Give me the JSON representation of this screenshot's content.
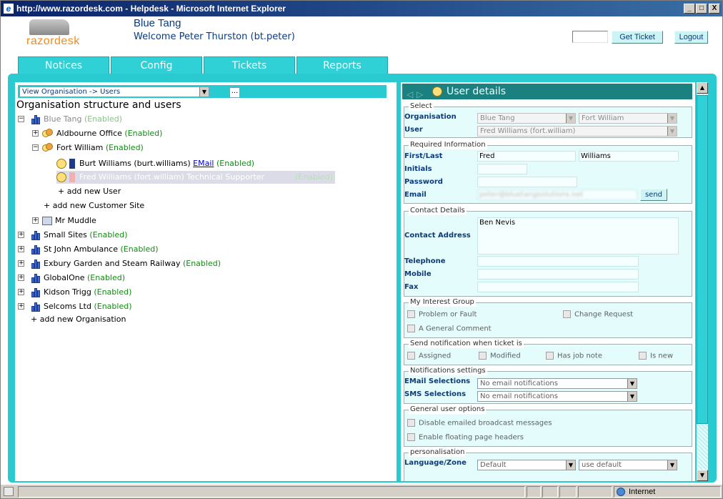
{
  "window": {
    "title": "http://www.razordesk.com - Helpdesk - Microsoft Internet Explorer",
    "min": "_",
    "max": "□",
    "close": "X"
  },
  "header": {
    "logo_text": "razordesk",
    "org_name": "Blue Tang",
    "welcome": "Welcome Peter Thurston (bt.peter)",
    "ticket_input": "",
    "get_ticket": "Get Ticket",
    "logout": "Logout"
  },
  "tabs": [
    {
      "label": "Notices"
    },
    {
      "label": "Config"
    },
    {
      "label": "Tickets"
    },
    {
      "label": "Reports"
    }
  ],
  "left": {
    "view_select": "View Organisation -> Users",
    "dots": "...",
    "title": "Organisation structure and users",
    "enabled": "(Enabled)",
    "tree": {
      "root": "Blue Tang",
      "aldbourne": "Aldbourne Office",
      "fortwilliam": "Fort William",
      "burt": "Burt Williams (burt.williams)",
      "burt_email": "EMail",
      "fred": "Fred Williams (fort.william) Technical Supporter",
      "add_user": "+ add new User",
      "add_site": "+ add new Customer Site",
      "mrmuddle": "Mr Muddle",
      "small": "Small Sites",
      "stjohn": "St John Ambulance",
      "exbury": "Exbury Garden and Steam Railway",
      "globalone": "GlobalOne",
      "kidson": "Kidson Trigg",
      "selcoms": "Selcoms Ltd",
      "add_org": "+ add new Organisation"
    }
  },
  "right": {
    "title": "User details",
    "select": {
      "legend": "Select",
      "org_label": "Organisation",
      "org_value": "Blue Tang",
      "site_value": "Fort William",
      "user_label": "User",
      "user_value": "Fred Williams (fort.william)"
    },
    "required": {
      "legend": "Required Information",
      "first_last_label": "First/Last",
      "first": "Fred",
      "last": "Williams",
      "initials_label": "Initials",
      "initials": "",
      "password_label": "Password",
      "password": "",
      "email_label": "Email",
      "email": "peter@bluetangsolutions.net",
      "send": "send"
    },
    "contact": {
      "legend": "Contact Details",
      "address_label": "Contact Address",
      "address": "Ben Nevis",
      "telephone_label": "Telephone",
      "mobile_label": "Mobile",
      "fax_label": "Fax"
    },
    "interest": {
      "legend": "My Interest Group",
      "problem": "Problem or Fault",
      "change": "Change Request",
      "general": "A General Comment"
    },
    "notify": {
      "legend": "Send notification when ticket is",
      "assigned": "Assigned",
      "modified": "Modified",
      "jobnote": "Has job note",
      "isnew": "Is new"
    },
    "notif_settings": {
      "legend": "Notifications settings",
      "email_label": "EMail Selections",
      "email_value": "No email notifications",
      "sms_label": "SMS Selections",
      "sms_value": "No email notifications"
    },
    "general": {
      "legend": "General user options",
      "broadcast": "Disable emailed broadcast messages",
      "floating": "Enable floating page headers"
    },
    "personal": {
      "legend": "personalisation",
      "lang_label": "Language/Zone",
      "lang_value": "Default",
      "zone_value": "use default"
    }
  },
  "status": {
    "zone": "Internet"
  }
}
